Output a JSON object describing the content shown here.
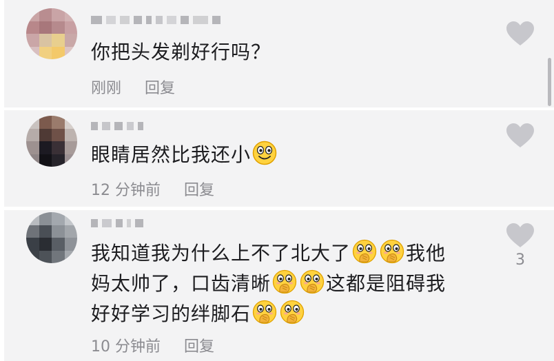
{
  "comments": [
    {
      "text_lines": [
        "你把头发剃好行吗？"
      ],
      "time": "刚刚",
      "reply_label": "回复",
      "like_count": ""
    },
    {
      "text_lines": [
        "眼睛居然比我还小"
      ],
      "time": "12 分钟前",
      "reply_label": "回复",
      "like_count": ""
    },
    {
      "text_lines": [
        "我知道我为什么上不了北大了",
        "我他",
        "妈太帅了，口齿清晰",
        "这都是阻碍我",
        "好好学习的绊脚石"
      ],
      "time": "10 分钟前",
      "reply_label": "回复",
      "like_count": "3"
    }
  ],
  "icons": {
    "like": "heart-icon",
    "smile": "smiling-face-emoji",
    "cover": "covering-mouth-emoji"
  },
  "colors": {
    "background": "#f3f3f4",
    "text": "#1d1d20",
    "meta": "#8b8b90",
    "like": "#c7c7cc"
  }
}
